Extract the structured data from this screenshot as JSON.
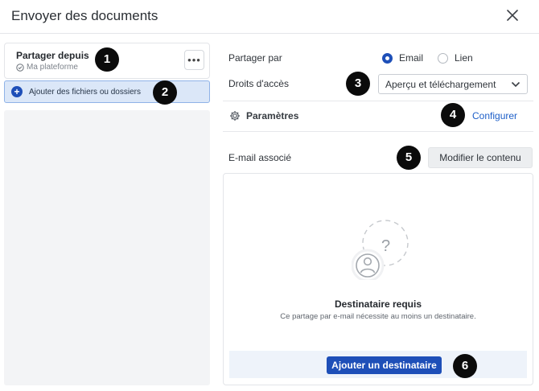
{
  "dialog": {
    "title": "Envoyer des documents"
  },
  "source": {
    "label": "Partager depuis",
    "platform": "Ma plateforme",
    "more": "•••"
  },
  "add_files": {
    "plus": "+",
    "label": "Ajouter des fichiers ou dossiers"
  },
  "share": {
    "label": "Partager par",
    "options": [
      "Email",
      "Lien"
    ],
    "selected": "Email"
  },
  "access": {
    "label": "Droits d'accès",
    "value": "Aperçu et téléchargement"
  },
  "settings": {
    "label": "Paramètres",
    "action": "Configurer"
  },
  "email": {
    "label": "E-mail associé",
    "modify": "Modifier le contenu"
  },
  "recipient": {
    "title": "Destinataire requis",
    "description": "Ce partage par e-mail nécessite au moins un destinataire.",
    "add_button": "Ajouter un destinataire"
  },
  "badges": [
    "1",
    "2",
    "3",
    "4",
    "5",
    "6"
  ],
  "icons": {
    "close": "close-icon",
    "verified": "check-circle-icon",
    "add": "plus-circle-icon",
    "gear": "gear-icon",
    "chevron": "chevron-down-icon",
    "placeholder": "user-question-icon"
  },
  "colors": {
    "accent": "#1e4fb8",
    "link": "#1e5fc8",
    "badge": "#0b0b0b",
    "selection_bg": "#dbe7f8"
  }
}
